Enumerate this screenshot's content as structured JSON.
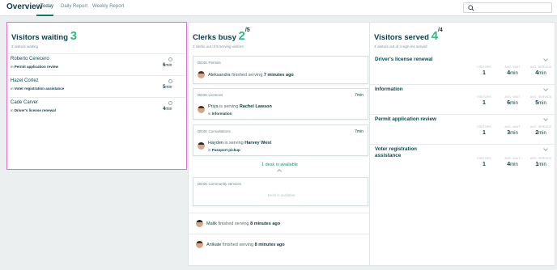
{
  "header": {
    "title": "Overview",
    "tabs": [
      {
        "label": "Today"
      },
      {
        "label": "Daily Report"
      },
      {
        "label": "Weekly Report"
      }
    ],
    "search_placeholder": ""
  },
  "waiting": {
    "title": "Visitors waiting",
    "count": "3",
    "subtitle": "3 visitors waiting",
    "visitors": [
      {
        "name": "Roberto Cerecero",
        "in": "in",
        "service": "Permit application review",
        "time": "6",
        "unit": "min"
      },
      {
        "name": "Hazel Cortez",
        "in": "in",
        "service": "Voter registration assistance",
        "time": "5",
        "unit": "min"
      },
      {
        "name": "Cade Carver",
        "in": "in",
        "service": "Driver's license renewal",
        "time": "4",
        "unit": "min"
      }
    ]
  },
  "clerks": {
    "title": "Clerks busy",
    "count": "2",
    "total": "/5",
    "subtitle": "2 clerks out of 5 serving visitors",
    "desks": [
      {
        "label": "DESK Permits",
        "time": "",
        "person": "Aleksandra",
        "verb": "finished serving",
        "target": "7 minutes ago",
        "in_label": "",
        "in_service": ""
      },
      {
        "label": "DESK Licences",
        "time": "7min",
        "person": "Priya",
        "verb": "is serving",
        "target": "Rachel Lawson",
        "in_label": "in",
        "in_service": "Information"
      },
      {
        "label": "DESK Consultations",
        "time": "7min",
        "person": "Hayden",
        "verb": "is serving",
        "target": "Harvey West",
        "in_label": "in",
        "in_service": "Passport pickup"
      }
    ],
    "available": "1 desk is available",
    "free_desk": {
      "label": "DESK Community services",
      "note": "Desk is available"
    },
    "finished": [
      {
        "person": "Malik",
        "verb": "finished serving",
        "when": "8 minutes ago"
      },
      {
        "person": "Anikate",
        "verb": "finished serving",
        "when": "8 minutes ago"
      }
    ]
  },
  "served": {
    "title": "Visitors served",
    "count": "4",
    "total": "/4",
    "subtitle": "4 visitors out of 4 sign-ins served",
    "headers": {
      "visitors": "VISITORS",
      "wait": "AVG. WAIT",
      "service": "AVG. SERVICE"
    },
    "services": [
      {
        "name": "Driver's license renewal",
        "visitors": "1",
        "wait": "4",
        "service": "4",
        "unit": "min"
      },
      {
        "name": "Information",
        "visitors": "1",
        "wait": "6",
        "service": "5",
        "unit": "min"
      },
      {
        "name": "Permit application review",
        "visitors": "1",
        "wait": "3",
        "service": "2",
        "unit": "min"
      },
      {
        "name": "Voter registration assistance",
        "visitors": "1",
        "wait": "4",
        "service": "1",
        "unit": "min"
      }
    ]
  },
  "colors": {
    "accent": "#2dbb7e",
    "highlight": "#e06bd8",
    "text": "#0d4a52"
  }
}
